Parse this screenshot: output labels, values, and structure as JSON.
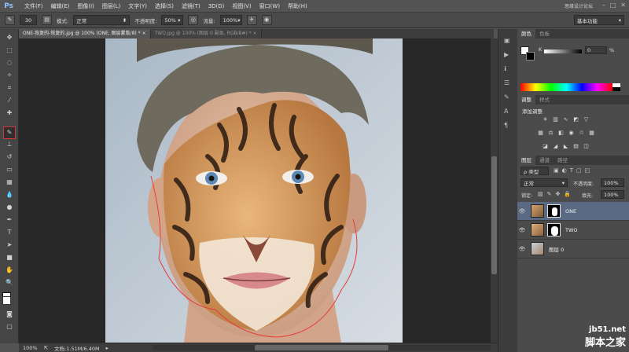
{
  "app": {
    "logo": "Ps",
    "workspace": "基本功能",
    "top_watermark": "思缘设计论坛"
  },
  "menu": [
    "文件(F)",
    "编辑(E)",
    "图像(I)",
    "图层(L)",
    "文字(Y)",
    "选择(S)",
    "滤镜(T)",
    "3D(D)",
    "视图(V)",
    "窗口(W)",
    "帮助(H)"
  ],
  "options": {
    "brush_size": "30",
    "mode_label": "模式:",
    "mode_value": "正常",
    "opacity_label": "不透明度:",
    "opacity_value": "50%",
    "flow_label": "流量:",
    "flow_value": "100%"
  },
  "tabs": [
    {
      "label": "ONE-恢复的-恢复的.jpg @ 100% (ONE, 图层蒙版/8) *",
      "active": true
    },
    {
      "label": "TWO.jpg @ 100% (图层 0 副本, RGB/8#) *",
      "active": false
    }
  ],
  "status": {
    "zoom": "100%",
    "doc": "文档:1.51M/6.40M"
  },
  "color_panel": {
    "tabs": [
      "颜色",
      "色板"
    ],
    "channel_label": "K",
    "value": "0",
    "unit": "%"
  },
  "adjust_panel": {
    "tabs": [
      "调整",
      "样式"
    ],
    "title": "添加调整"
  },
  "layers_panel": {
    "tabs": [
      "图层",
      "通道",
      "路径"
    ],
    "filter_label": "ρ 类型",
    "blend_mode": "正常",
    "opacity_label": "不透明度:",
    "opacity_value": "100%",
    "lock_label": "锁定:",
    "fill_label": "填充:",
    "fill_value": "100%",
    "layers": [
      {
        "name": "ONE",
        "active": true,
        "has_mask": true
      },
      {
        "name": "TWO",
        "active": false,
        "has_mask": true
      },
      {
        "name": "图层 0",
        "active": false,
        "has_mask": false
      }
    ]
  },
  "watermark": {
    "line1": "jb51.net",
    "line2": "脚本之家"
  },
  "colors": {
    "accent_selection": "#d43a3a",
    "active_layer": "#5a6a82"
  }
}
